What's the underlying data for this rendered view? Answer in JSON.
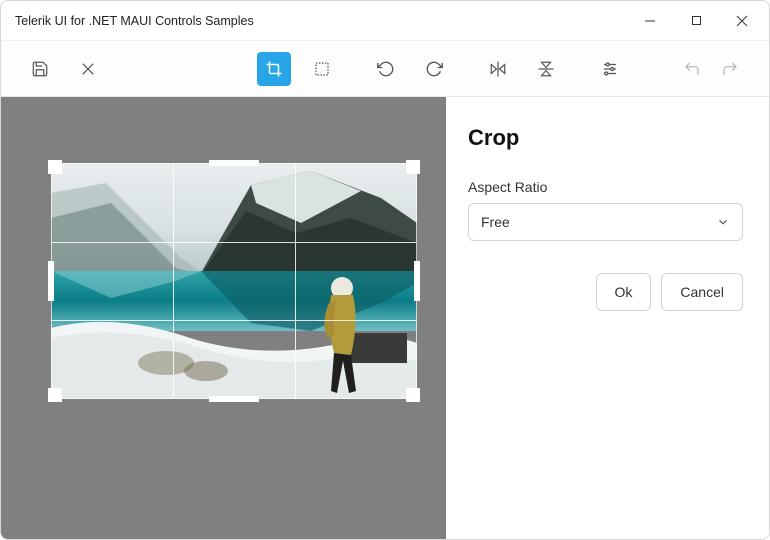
{
  "window": {
    "title": "Telerik UI for .NET MAUI Controls Samples"
  },
  "toolbar": {
    "save": "save-icon",
    "close": "close-icon",
    "crop": "crop-icon",
    "resize": "resize-icon",
    "rotate_ccw": "rotate-ccw-icon",
    "rotate_cw": "rotate-cw-icon",
    "flip_h": "flip-horizontal-icon",
    "flip_v": "flip-vertical-icon",
    "filters": "filters-icon",
    "undo": "undo-icon",
    "redo": "redo-icon"
  },
  "panel": {
    "title": "Crop",
    "aspect_label": "Aspect Ratio",
    "aspect_value": "Free",
    "ok_label": "Ok",
    "cancel_label": "Cancel"
  }
}
